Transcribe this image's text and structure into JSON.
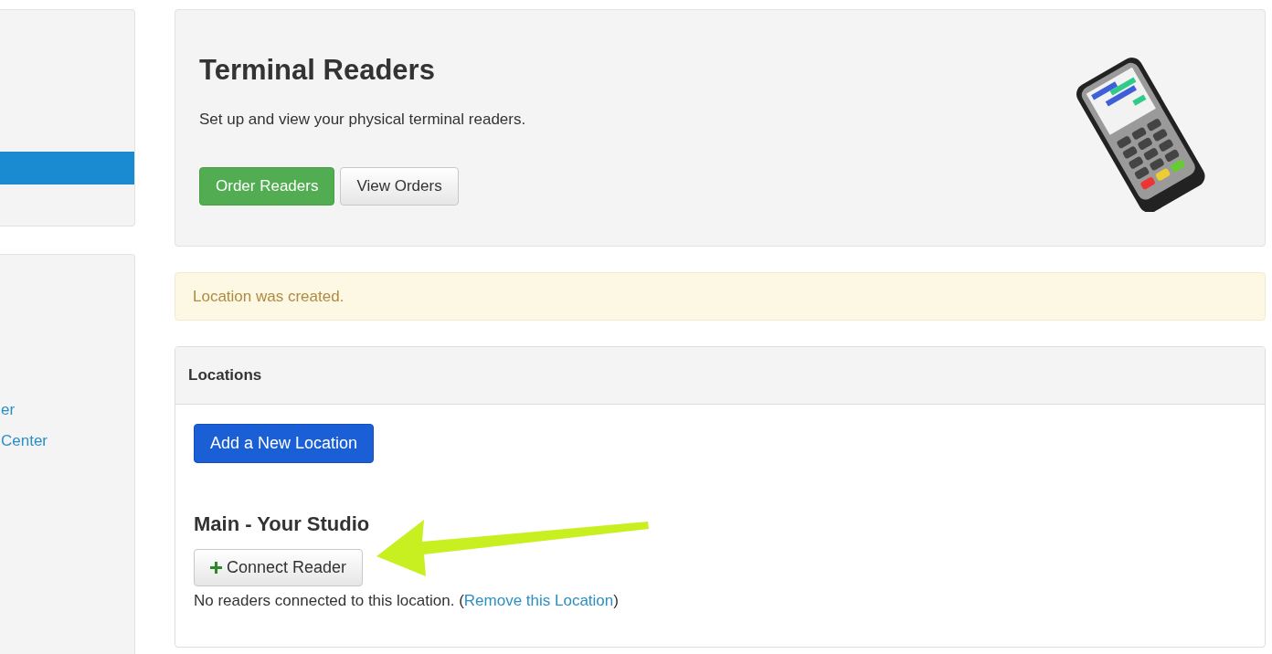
{
  "sidebar": {
    "nav_items": [
      {
        "selected": true
      }
    ],
    "links": [
      "er",
      "Center"
    ]
  },
  "header": {
    "title": "Terminal Readers",
    "subtitle": "Set up and view your physical terminal readers.",
    "buttons": [
      {
        "label": "Order Readers",
        "kind": "success"
      },
      {
        "label": "View Orders",
        "kind": "default"
      }
    ]
  },
  "alert": {
    "message": "Location was created."
  },
  "locations": {
    "heading": "Locations",
    "add_button": "Add a New Location",
    "items": [
      {
        "name": "Main - Your Studio",
        "connect_button": "Connect Reader",
        "status": "No readers connected to this location.",
        "open_paren": "(",
        "remove_link": "Remove this Location",
        "close_paren": ")"
      }
    ]
  }
}
